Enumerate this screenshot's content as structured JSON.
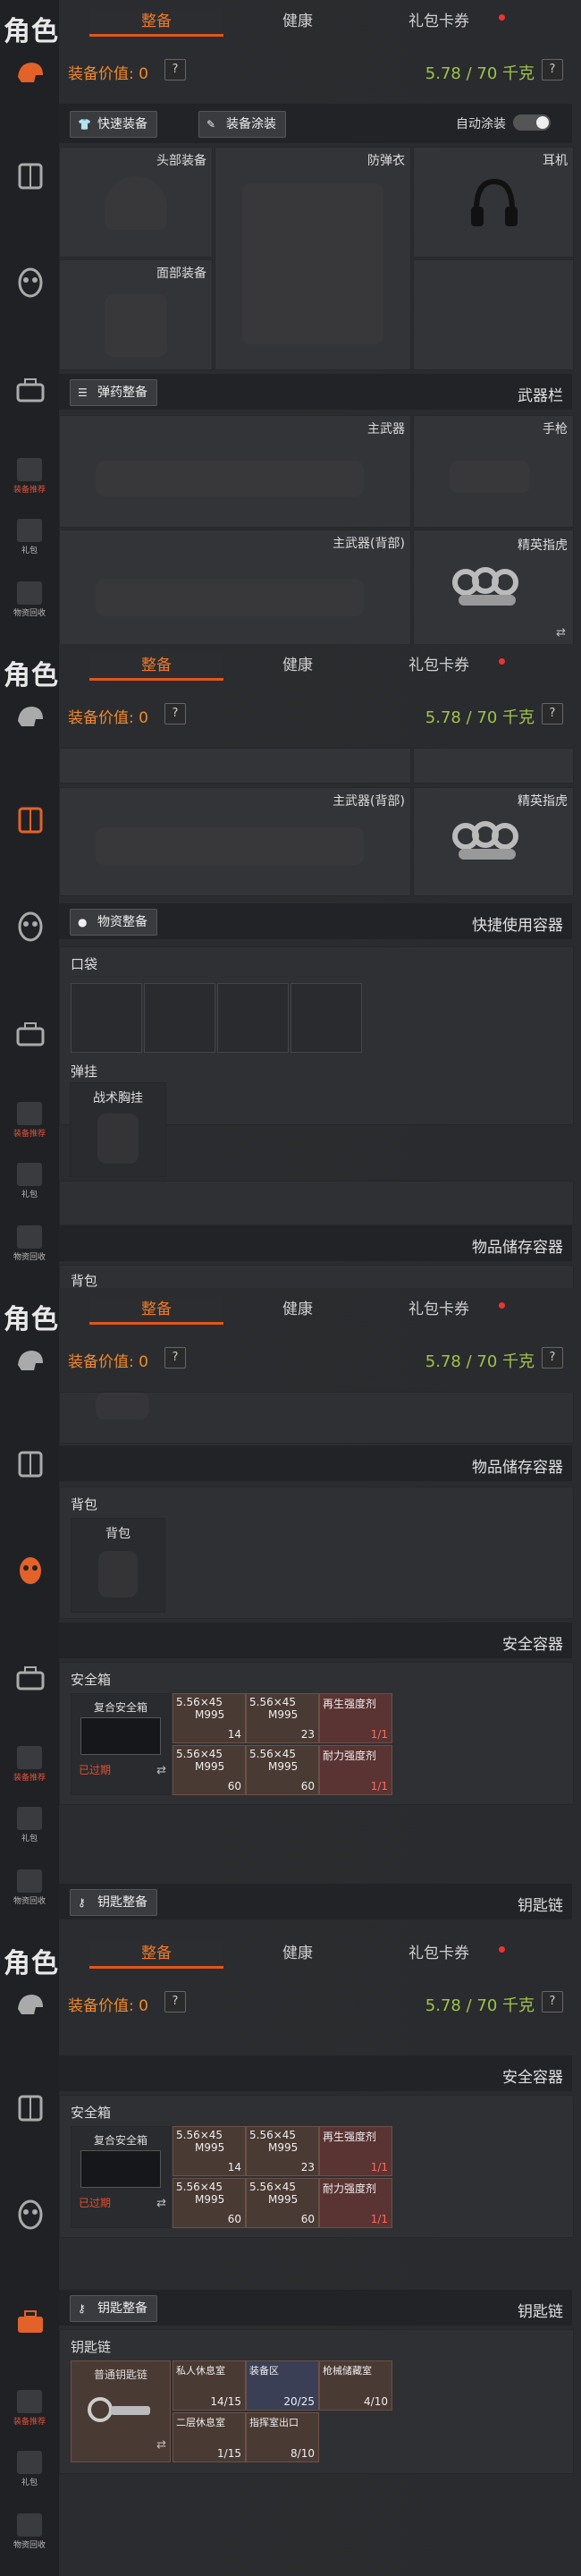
{
  "sidebar": {
    "title": "角色",
    "items": [
      {
        "label": "装备推荐"
      },
      {
        "label": "礼包"
      },
      {
        "label": "物资回收"
      }
    ]
  },
  "tabs": [
    "整备",
    "健康",
    "礼包卡券"
  ],
  "value": {
    "label": "装备价值: 0",
    "weight": "5.78 / 70 千克",
    "help": "?"
  },
  "loadout": {
    "quick_equip": "快速装备",
    "paint": "装备涂装",
    "auto_paint": "自动涂装",
    "slots": {
      "head": "头部装备",
      "armor": "防弹衣",
      "ear": "耳机",
      "face": "面部装备"
    },
    "ammo_button": "弹药整备",
    "weapons_header": "武器栏",
    "primary": "主武器",
    "pistol": "手枪",
    "primary_back": "主武器(背部)",
    "melee_name": "精英指虎"
  },
  "supplies": {
    "button": "物资整备",
    "right_header": "快捷使用容器",
    "pocket_label": "口袋",
    "rig_label": "弹挂",
    "rig_item": "战术胸挂",
    "storage_header": "物品储存容器",
    "backpack_label": "背包",
    "backpack_item": "背包"
  },
  "safe": {
    "header": "安全容器",
    "label": "安全箱",
    "box_name": "复合安全箱",
    "expired": "已过期",
    "items": [
      {
        "name": "5.56×45",
        "sub": "M995",
        "count": "14"
      },
      {
        "name": "5.56×45",
        "sub": "M995",
        "count": "23"
      },
      {
        "name": "再生强度剂",
        "count": "1/1"
      },
      {
        "name": "5.56×45",
        "sub": "M995",
        "count": "60"
      },
      {
        "name": "5.56×45",
        "sub": "M995",
        "count": "60"
      },
      {
        "name": "耐力强度剂",
        "count": "1/1"
      }
    ]
  },
  "keys": {
    "button": "钥匙整备",
    "header": "钥匙链",
    "label": "钥匙链",
    "box_name": "普通钥匙链",
    "items": [
      {
        "name": "私人休息室",
        "count": "14/15"
      },
      {
        "name": "装备区",
        "count": "20/25"
      },
      {
        "name": "枪械储藏室",
        "count": "4/10"
      },
      {
        "name": "二层休息室",
        "count": "1/15"
      },
      {
        "name": "指挥室出口",
        "count": "8/10"
      }
    ]
  }
}
